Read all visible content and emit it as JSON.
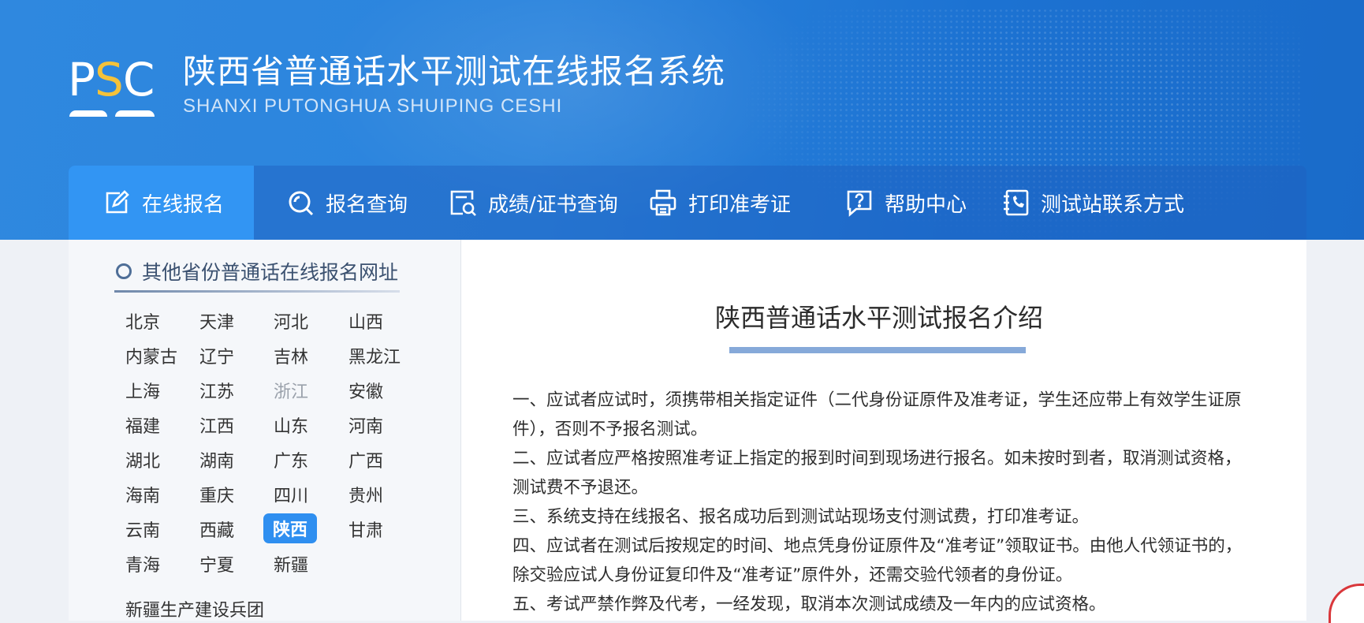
{
  "header": {
    "logo_text_p": "P",
    "logo_text_s": "S",
    "logo_text_c": "C",
    "title": "陕西省普通话水平测试在线报名系统",
    "subtitle": "SHANXI PUTONGHUA SHUIPING CESHI"
  },
  "nav": {
    "items": [
      {
        "label": "在线报名",
        "icon": "edit-icon"
      },
      {
        "label": "报名查询",
        "icon": "search-icon"
      },
      {
        "label": "成绩/证书查询",
        "icon": "certificate-search-icon"
      },
      {
        "label": "打印准考证",
        "icon": "printer-icon"
      },
      {
        "label": "帮助中心",
        "icon": "help-icon"
      },
      {
        "label": "测试站联系方式",
        "icon": "phone-book-icon"
      }
    ]
  },
  "sidebar": {
    "heading": "其他省份普通话在线报名网址",
    "provinces": [
      "北京",
      "天津",
      "河北",
      "山西",
      "内蒙古",
      "辽宁",
      "吉林",
      "黑龙江",
      "上海",
      "江苏",
      "浙江",
      "安徽",
      "福建",
      "江西",
      "山东",
      "河南",
      "湖北",
      "湖南",
      "广东",
      "广西",
      "海南",
      "重庆",
      "四川",
      "贵州",
      "云南",
      "西藏",
      "陕西",
      "甘肃",
      "青海",
      "宁夏",
      "新疆"
    ],
    "extra": "新疆生产建设兵团",
    "selected": "陕西",
    "muted": "浙江"
  },
  "main": {
    "title": "陕西普通话水平测试报名介绍",
    "paragraphs": [
      "一、应试者应试时，须携带相关指定证件（二代身份证原件及准考证，学生还应带上有效学生证原件），否则不予报名测试。",
      "二、应试者应严格按照准考证上指定的报到时间到现场进行报名。如未按时到者，取消测试资格，测试费不予退还。",
      "三、系统支持在线报名、报名成功后到测试站现场支付测试费，打印准考证。",
      "四、应试者在测试后按规定的时间、地点凭身份证原件及“准考证”领取证书。由他人代领证书的，除交验应试人身份证复印件及“准考证”原件外，还需交验代领者的身份证。",
      "五、考试严禁作弊及代考，一经发现，取消本次测试成绩及一年内的应试资格。"
    ]
  },
  "colors": {
    "banner": "#2b84dd",
    "nav_active": "#3295f3",
    "accent_gold": "#f5c23a",
    "selected_badge": "#2f8ff0"
  }
}
